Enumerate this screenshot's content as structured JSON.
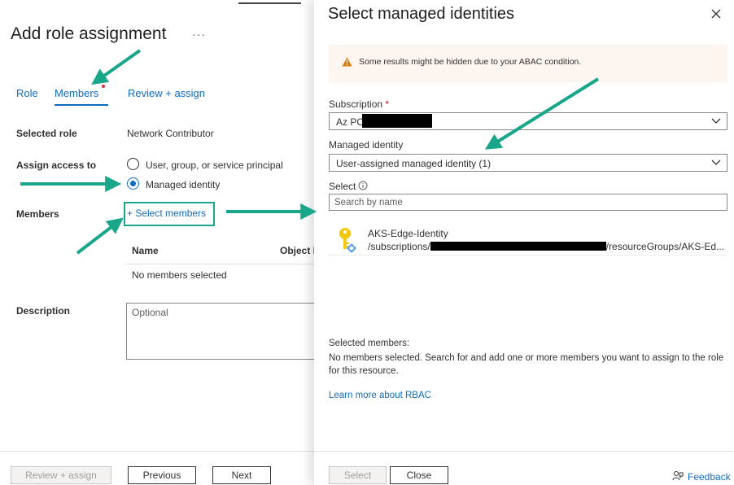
{
  "left": {
    "title": "Add role assignment",
    "more": "···",
    "tabs": [
      {
        "label": "Role"
      },
      {
        "label": "Members"
      },
      {
        "label": "Review + assign"
      }
    ],
    "selected_role_label": "Selected role",
    "selected_role_value": "Network Contributor",
    "assign_access_label": "Assign access to",
    "options": [
      {
        "label": "User, group, or service principal",
        "checked": false
      },
      {
        "label": "Managed identity",
        "checked": true
      }
    ],
    "members_label": "Members",
    "select_members": "+ Select members",
    "table_headers": [
      "Name",
      "Object I"
    ],
    "no_members": "No members selected",
    "description_label": "Description",
    "description_placeholder": "Optional",
    "buttons": {
      "review": "Review + assign",
      "previous": "Previous",
      "next": "Next"
    }
  },
  "panel": {
    "title": "Select managed identities",
    "warning": "Some results might be hidden due to your ABAC condition.",
    "subscription_label": "Subscription",
    "required_mark": "*",
    "subscription_value": "Az PO",
    "managed_identity_label": "Managed identity",
    "managed_identity_value": "User-assigned managed identity (1)",
    "select_label": "Select",
    "search_placeholder": "Search by name",
    "results": [
      {
        "name": "AKS-Edge-Identity",
        "path_prefix": "/subscriptions/",
        "path_suffix": "/resourceGroups/AKS-Ed..."
      }
    ],
    "selected_members_heading": "Selected members:",
    "selected_members_text": "No members selected. Search for and add one or more members you want to assign to the role for this resource.",
    "learn_more": "Learn more about RBAC",
    "buttons": {
      "select": "Select",
      "close": "Close"
    },
    "feedback": "Feedback"
  },
  "colors": {
    "accent": "#0f6cbd",
    "annotation_arrow": "#1aa68a",
    "warning_icon": "#d67f0a",
    "warning_bg": "#fdf6f0",
    "key_icon": "#f2c811"
  }
}
